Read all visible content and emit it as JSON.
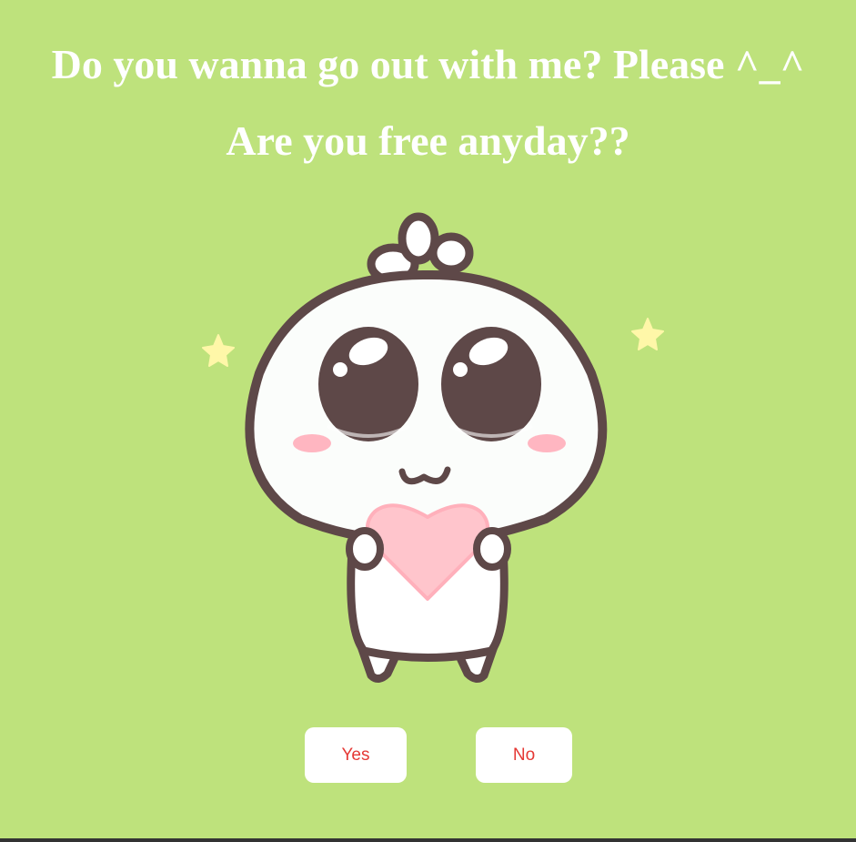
{
  "heading": {
    "line1": "Do you wanna go out with me? Please ^_^",
    "line2": "Are you free anyday??"
  },
  "illustration": {
    "icon": "cute-character-holding-heart-icon"
  },
  "buttons": {
    "yes_label": "Yes",
    "no_label": "No"
  },
  "colors": {
    "background": "#bee27c",
    "heading_text": "#ffffff",
    "button_bg": "#ffffff",
    "button_text": "#e53935",
    "heart": "#ffc5cc",
    "outline": "#5e4848"
  }
}
